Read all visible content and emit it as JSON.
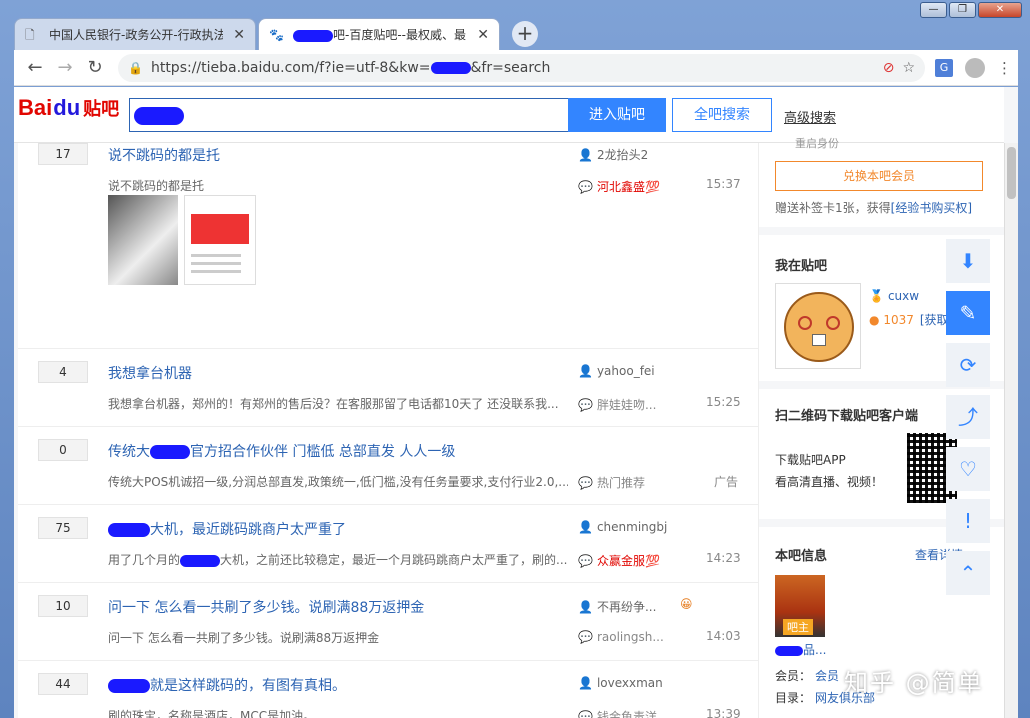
{
  "window": {
    "min": "—",
    "max": "❐",
    "close": "✕"
  },
  "tabs": [
    {
      "title": "中国人民银行-政务公开-行政执法",
      "icon": "document-icon"
    },
    {
      "title": "吧-百度贴吧--最权威、最",
      "icon": "paw-icon"
    }
  ],
  "address": {
    "url": "https://tieba.baidu.com/f?ie=utf-8&kw=",
    "url_tail": "&fr=search"
  },
  "header": {
    "logo_bai": "Bai",
    "logo_du": "du",
    "logo_tieba": "贴吧",
    "enter_button": "进入贴吧",
    "all_search_button": "全吧搜索",
    "advanced_search": "高级搜索"
  },
  "threads": [
    {
      "replies": "17",
      "title": "说不跳码的都是托",
      "abstract": "说不跳码的都是托",
      "author": "2龙抬头2",
      "last_reply": "河北鑫盛💯",
      "time": "15:37"
    },
    {
      "replies": "4",
      "title": "我想拿台机器",
      "abstract": "我想拿台机器，郑州的！有郑州的售后没？在客服那留了电话都10天了 还没联系我...",
      "author": "yahoo_fei",
      "last_reply": "胖娃娃吻...",
      "time": "15:25"
    },
    {
      "replies": "0",
      "title_pre": "传统大",
      "title_post": "官方招合作伙伴 门槛低 总部直发 人人一级",
      "abstract": "传统大POS机诚招一级,分润总部直发,政策统一,低门槛,没有任务量要求,支付行业2.0,...",
      "author": "",
      "last_reply": "热门推荐",
      "time": "广告"
    },
    {
      "replies": "75",
      "title": "大机，最近跳码跳商户太严重了",
      "abstract_pre": "用了几个月的",
      "abstract_post": "大机，之前还比较稳定，最近一个月跳码跳商户太严重了，刷的...",
      "author": "chenmingbj",
      "last_reply": "众赢金服💯",
      "time": "14:23"
    },
    {
      "replies": "10",
      "title": "问一下 怎么看一共刷了多少钱。说刷满88万返押金",
      "abstract": "问一下 怎么看一共刷了多少钱。说刷满88万返押金",
      "author": "不再纷争...",
      "last_reply": "raolingsh...",
      "time": "14:03"
    },
    {
      "replies": "44",
      "title": "就是这样跳码的，有图有真相。",
      "abstract": "刷的珠宝，名称是酒店，MCC是加油。",
      "author": "lovexxman",
      "last_reply": "钱金鱼毒洋",
      "time": "13:39"
    }
  ],
  "sidebar": {
    "upgrade_label": "重启身份",
    "member_button": "兑换本吧会员",
    "note_text": "赠送补签卡1张，获得",
    "note_link": "[经验书购买权]",
    "my_tieba_heading": "我在贴吧",
    "username": "cuxw",
    "coins": "1037",
    "get_link": "[获取]",
    "qr_heading": "扫二维码下载贴吧客户端",
    "qr_line1": "下载贴吧APP",
    "qr_line2": "看高清直播、视频！",
    "info_heading": "本吧信息",
    "view_more": "查看详情",
    "owner_tag": "吧主",
    "owner_name": "品...",
    "member_label": "会员：",
    "member_value": "会员",
    "dir_label": "目录：",
    "dir_value": "网友俱乐部"
  },
  "watermark": "知乎 @简单"
}
